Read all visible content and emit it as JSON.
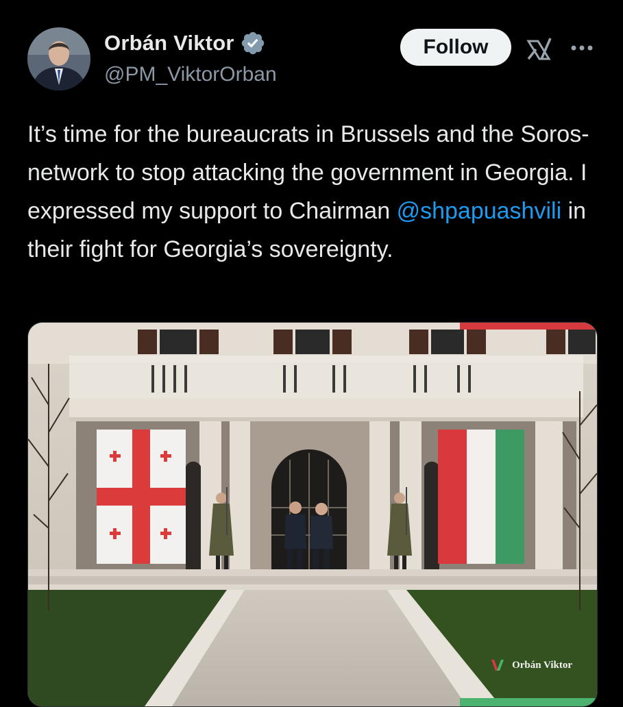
{
  "author": {
    "display_name": "Orbán Viktor",
    "handle": "@PM_ViktorOrban",
    "verified": true,
    "avatar_icon": "person-portrait"
  },
  "actions": {
    "follow_label": "Follow",
    "grok_icon": "grok-icon",
    "more_icon": "more-icon"
  },
  "tweet": {
    "text_before": "It’s time for the bureaucrats in Brussels and the Soros-network to stop attacking the government in Georgia. I expressed my support to Chairman ",
    "mention": "@shpapuashvili",
    "text_after": " in their fight for Georgia’s sovereignty."
  },
  "media": {
    "description_icon": "photo",
    "watermark": "Orbán Viktor"
  },
  "colors": {
    "background": "#000000",
    "text": "#e7e9ea",
    "secondary": "#8b98a5",
    "link": "#1d9bf0",
    "verified": "#829aab"
  }
}
